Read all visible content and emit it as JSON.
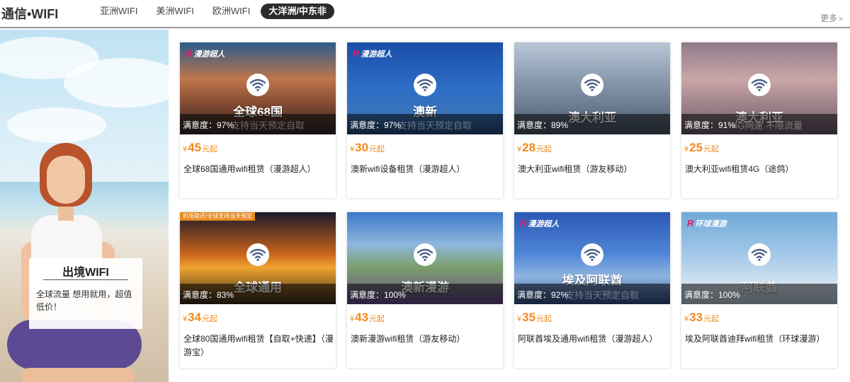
{
  "header": {
    "brand": "通信•WIFI",
    "tabs": [
      {
        "label": "亚洲WIFI",
        "active": false
      },
      {
        "label": "美洲WIFI",
        "active": false
      },
      {
        "label": "欧洲WIFI",
        "active": false
      },
      {
        "label": "大洋洲/中东非",
        "active": true
      }
    ],
    "more": "更多",
    "more_icon": "chevron-right-icon"
  },
  "banner": {
    "title": "出境WIFI",
    "desc": "全球流量 想用就用，超值低价！"
  },
  "price_suffix": "元起",
  "currency": "¥",
  "colors": {
    "price": "#f08a1c",
    "active_tab_bg": "#2b2b2b",
    "logo_accent": "#e2196a"
  },
  "products": [
    {
      "satisfaction": "满意度：97%",
      "price": "45",
      "name": "全球68国通用wifi租赁（漫游超人）",
      "overlay": "全球68国",
      "ghost": "支持当天预定自取",
      "logo": "漫游超人"
    },
    {
      "satisfaction": "满意度：97%",
      "price": "30",
      "name": "澳新wifi设备租赁（漫游超人）",
      "overlay": "澳新",
      "ghost": "支持当天预定自取",
      "logo": "漫游超人"
    },
    {
      "satisfaction": "满意度：89%",
      "price": "28",
      "name": "澳大利亚wifi租赁（游友移动）",
      "overlay": "澳大利亚",
      "ghost": "",
      "logo": ""
    },
    {
      "satisfaction": "满意度：91%",
      "price": "25",
      "name": "澳大利亚wifi租赁4G（途鸽）",
      "overlay": "澳大利亚",
      "ghost": "4G网速 不限流量",
      "logo": ""
    },
    {
      "satisfaction": "满意度：83%",
      "price": "34",
      "name": "全球80国通用wifi租赁【自取+快递】（漫游宝）",
      "overlay": "全球通用",
      "ghost": "",
      "logo": "",
      "promo": "机场取还/全球支持当天预定"
    },
    {
      "satisfaction": "满意度：100%",
      "price": "43",
      "name": "澳新漫游wifi租赁（游友移动）",
      "overlay": "澳新漫游",
      "ghost": "",
      "logo": ""
    },
    {
      "satisfaction": "满意度：92%",
      "price": "35",
      "name": "阿联酋埃及通用wifi租赁（漫游超人）",
      "overlay": "埃及阿联酋",
      "ghost": "支持当天预定自取",
      "logo": "漫游超人"
    },
    {
      "satisfaction": "满意度：100%",
      "price": "33",
      "name": "埃及阿联酋迪拜wifi租赁（环球漫游）",
      "overlay": "阿联酋",
      "ghost": "",
      "logo": "环球漫游"
    }
  ]
}
